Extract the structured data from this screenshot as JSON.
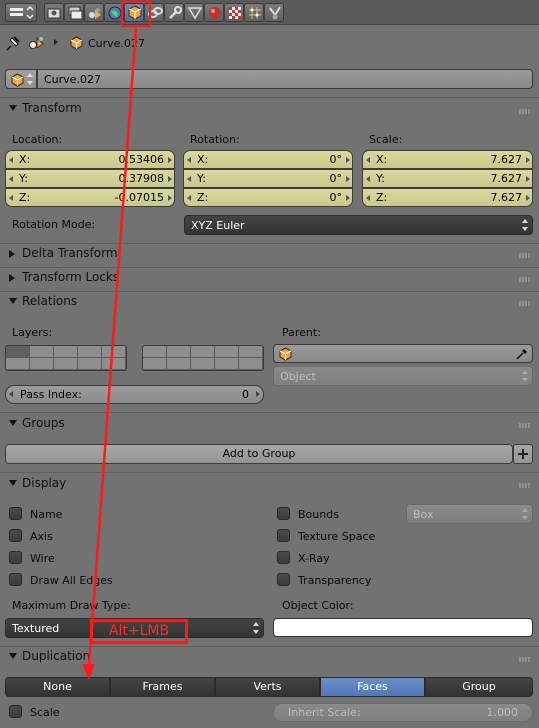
{
  "header": {
    "buttons": [
      {
        "icon": "render-icon"
      },
      {
        "icon": "render-layers-icon"
      },
      {
        "icon": "scene-icon"
      },
      {
        "icon": "world-icon"
      },
      {
        "icon": "object-icon",
        "active": true
      },
      {
        "icon": "constraints-icon"
      },
      {
        "icon": "modifiers-icon"
      },
      {
        "icon": "object-data-icon"
      },
      {
        "icon": "material-icon"
      },
      {
        "icon": "texture-icon"
      },
      {
        "icon": "particles-icon"
      },
      {
        "icon": "physics-icon"
      }
    ]
  },
  "breadcrumb": {
    "object_name": "Curve.027"
  },
  "object_field": {
    "value": "Curve.027"
  },
  "transform": {
    "title": "Transform",
    "location_label": "Location:",
    "rotation_label": "Rotation:",
    "scale_label": "Scale:",
    "location": [
      {
        "axis": "X:",
        "value": "0.53406"
      },
      {
        "axis": "Y:",
        "value": "0.37908"
      },
      {
        "axis": "Z:",
        "value": "-0.07015"
      }
    ],
    "rotation": [
      {
        "axis": "X:",
        "value": "0°"
      },
      {
        "axis": "Y:",
        "value": "0°"
      },
      {
        "axis": "Z:",
        "value": "0°"
      }
    ],
    "scale": [
      {
        "axis": "X:",
        "value": "7.627"
      },
      {
        "axis": "Y:",
        "value": "7.627"
      },
      {
        "axis": "Z:",
        "value": "7.627"
      }
    ],
    "rotation_mode_label": "Rotation Mode:",
    "rotation_mode_value": "XYZ Euler"
  },
  "panels": {
    "delta_transform": "Delta Transform",
    "transform_locks": "Transform Locks",
    "relations": "Relations",
    "groups": "Groups",
    "display": "Display",
    "duplication": "Duplication"
  },
  "relations": {
    "layers_label": "Layers:",
    "parent_label": "Parent:",
    "parent_type": "Object",
    "pass_index_label": "Pass Index:",
    "pass_index_value": "0"
  },
  "groups": {
    "add_button": "Add to Group"
  },
  "display": {
    "checkboxes_left": [
      "Name",
      "Axis",
      "Wire",
      "Draw All Edges"
    ],
    "checkboxes_right": [
      "Bounds",
      "Texture Space",
      "X-Ray",
      "Transparency"
    ],
    "bounds_type": "Box",
    "max_draw_type_label": "Maximum Draw Type:",
    "max_draw_type_value": "Textured",
    "object_color_label": "Object Color:"
  },
  "annotation": {
    "text": "Alt+LMB",
    "color": "#ff1a1a"
  },
  "duplication": {
    "options": [
      "None",
      "Frames",
      "Verts",
      "Faces",
      "Group"
    ],
    "active": "Faces",
    "scale_label": "Scale",
    "inherit_scale_label": "Inherit Scale:",
    "inherit_scale_value": "1.000"
  }
}
